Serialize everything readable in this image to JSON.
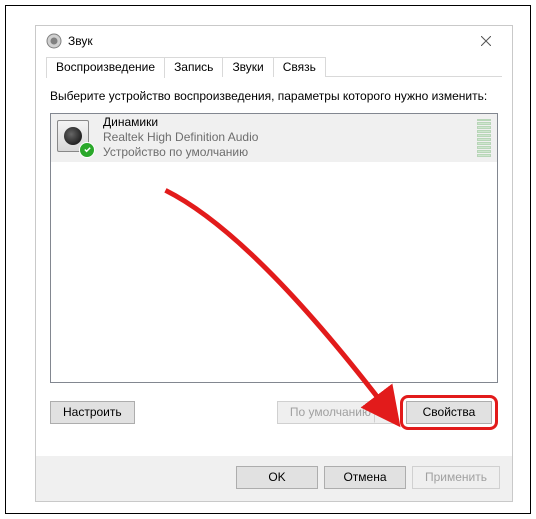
{
  "title": "Звук",
  "tabs": [
    {
      "label": "Воспроизведение",
      "active": true
    },
    {
      "label": "Запись",
      "active": false
    },
    {
      "label": "Звуки",
      "active": false
    },
    {
      "label": "Связь",
      "active": false
    }
  ],
  "instruction": "Выберите устройство воспроизведения, параметры которого нужно изменить:",
  "devices": [
    {
      "name": "Динамики",
      "description": "Realtek High Definition Audio",
      "status": "Устройство по умолчанию",
      "default": true
    }
  ],
  "buttons": {
    "configure": "Настроить",
    "set_default": "По умолчанию",
    "properties": "Свойства",
    "ok": "OK",
    "cancel": "Отмена",
    "apply": "Применить"
  },
  "icons": {
    "app": "speaker-volume-icon",
    "close": "close-icon",
    "device": "speaker-icon",
    "check": "check-icon"
  },
  "annotation": {
    "arrow_color": "#e21b1b",
    "highlight_target": "properties-button"
  }
}
